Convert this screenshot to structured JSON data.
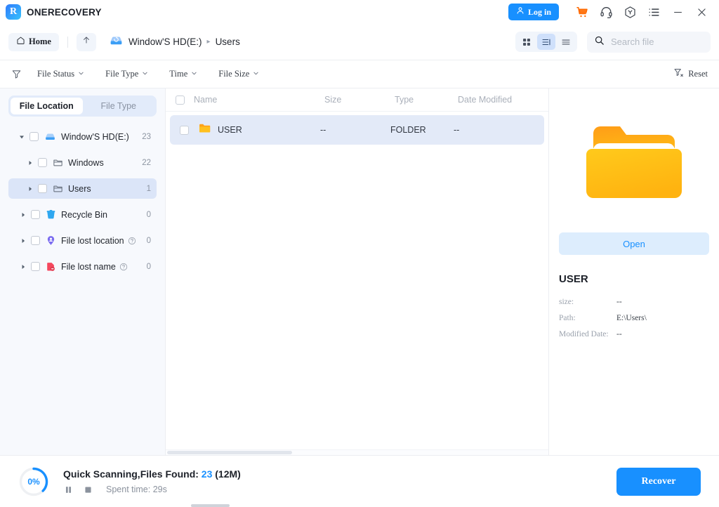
{
  "app": {
    "logo_letter": "R",
    "name": "ONERECOVERY"
  },
  "titlebar": {
    "login_label": "Log in",
    "icons": [
      {
        "name": "user-icon"
      },
      {
        "name": "cart-icon"
      },
      {
        "name": "headset-icon"
      },
      {
        "name": "upgrade-hexagon-icon"
      },
      {
        "name": "menu-list-icon"
      },
      {
        "name": "minimize-icon"
      },
      {
        "name": "close-icon"
      }
    ]
  },
  "breadcrumb": {
    "home_label": "Home",
    "up_icon": "arrow-up-icon",
    "drive_icon": "hard-drive-icon",
    "items": [
      {
        "label": "Window'S HD(E:)"
      },
      {
        "label": "Users"
      }
    ],
    "separator": "▸"
  },
  "view_toggle": {
    "options": [
      {
        "name": "grid-view",
        "active": false
      },
      {
        "name": "detail-view",
        "active": true
      },
      {
        "name": "list-view",
        "active": false
      }
    ]
  },
  "search": {
    "placeholder": "Search file",
    "value": "",
    "icon": "search-icon"
  },
  "filters": {
    "filter_icon": "filter-icon",
    "items": [
      {
        "label": "File Status"
      },
      {
        "label": "File Type"
      },
      {
        "label": "Time"
      },
      {
        "label": "File Size"
      }
    ],
    "caret": "⌄",
    "reset_label": "Reset",
    "reset_icon": "filter-reset-icon"
  },
  "sidebar": {
    "tabs": [
      {
        "label": "File Location",
        "active": true
      },
      {
        "label": "File Type",
        "active": false
      }
    ],
    "tree": [
      {
        "label": "Window'S HD(E:)",
        "count": "23",
        "icon": "hard-drive-icon",
        "expanded": true,
        "indent": 0,
        "selected": false,
        "help": false
      },
      {
        "label": "Windows",
        "count": "22",
        "icon": "folder-outline-icon",
        "expanded": false,
        "indent": 1,
        "selected": false,
        "help": false
      },
      {
        "label": "Users",
        "count": "1",
        "icon": "folder-outline-icon",
        "expanded": false,
        "indent": 1,
        "selected": true,
        "help": false
      },
      {
        "label": "Recycle Bin",
        "count": "0",
        "icon": "recycle-bin-icon",
        "expanded": false,
        "indent": 0,
        "selected": false,
        "help": false
      },
      {
        "label": "File lost location",
        "count": "0",
        "icon": "lost-location-icon",
        "expanded": false,
        "indent": 0,
        "selected": false,
        "help": true
      },
      {
        "label": "File lost name",
        "count": "0",
        "icon": "lost-name-icon",
        "expanded": false,
        "indent": 0,
        "selected": false,
        "help": true
      }
    ]
  },
  "filelist": {
    "columns": [
      "Name",
      "Size",
      "Type",
      "Date Modified"
    ],
    "rows": [
      {
        "name": "USER",
        "size": "--",
        "type": "FOLDER",
        "date": "--",
        "icon": "folder-icon",
        "selected": true,
        "checked": false
      }
    ]
  },
  "preview": {
    "icon": "folder-large-icon",
    "open_label": "Open",
    "title": "USER",
    "meta": [
      {
        "key": "size:",
        "value": "--"
      },
      {
        "key": "Path:",
        "value": "E:\\Users\\"
      },
      {
        "key": "Modified Date:",
        "value": "--"
      }
    ]
  },
  "status": {
    "percent": "0%",
    "percent_value": 0,
    "scan_prefix": "Quick Scanning,Files Found:",
    "files_found": "23",
    "size_found": "(12M)",
    "pause_icon": "pause-icon",
    "stop_icon": "stop-icon",
    "spent_time": "Spent time: 29s",
    "recover_label": "Recover"
  },
  "colors": {
    "accent": "#1890ff",
    "accent_light": "#ddedfd",
    "selected_row": "#e3eaf8",
    "sidebar_bg": "#f7f9fd",
    "folder_orange": "#ffa726",
    "folder_yellow": "#ffc926",
    "cart_orange": "#ff6a00",
    "recycle_blue": "#2ea7f0",
    "lost_name_red": "#f5485e"
  }
}
